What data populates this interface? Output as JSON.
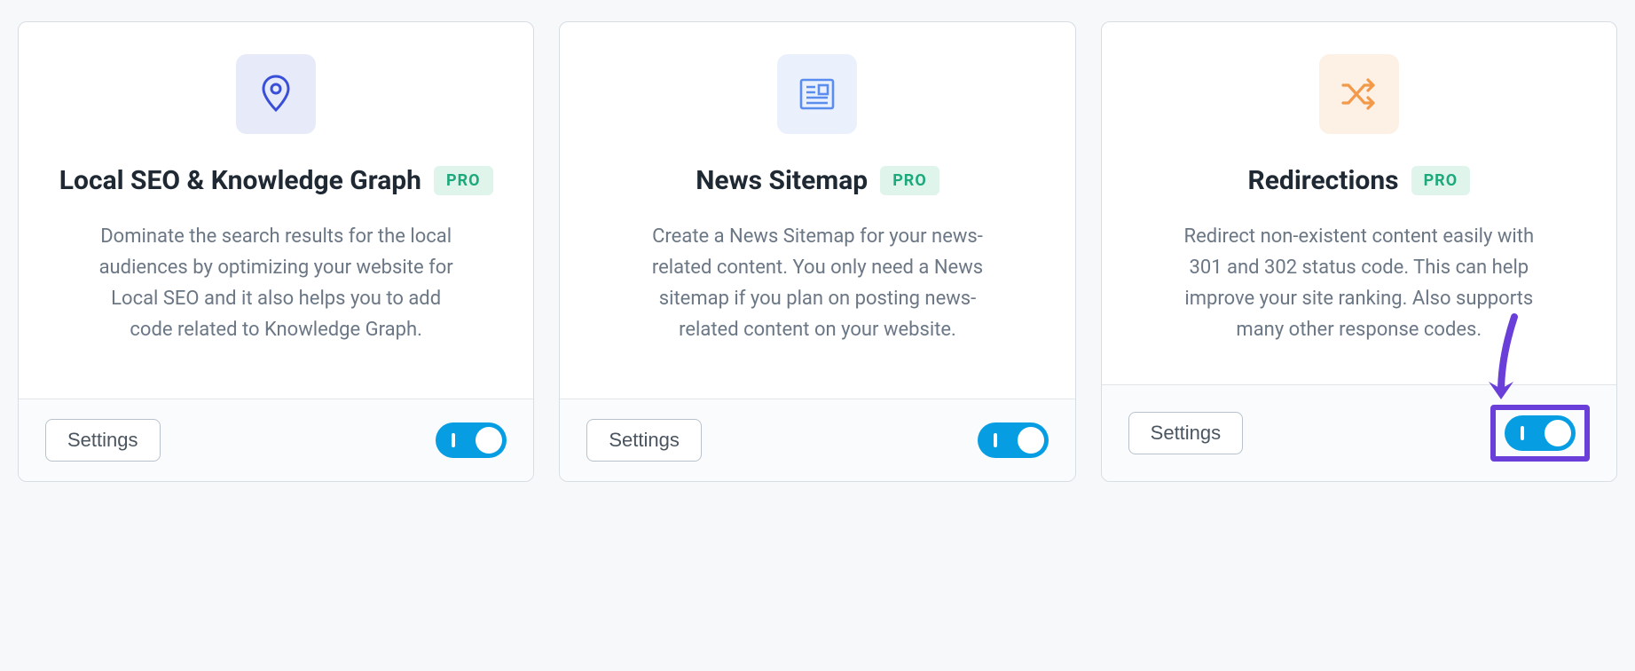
{
  "badge_label": "PRO",
  "settings_label": "Settings",
  "cards": [
    {
      "id": "local-seo",
      "title": "Local SEO & Knowledge Graph",
      "desc": "Dominate the search results for the local audiences by optimizing your website for Local SEO and it also helps you to add code related to Knowledge Graph.",
      "pro": true,
      "toggle_on": true,
      "highlight": false
    },
    {
      "id": "news-sitemap",
      "title": "News Sitemap",
      "desc": "Create a News Sitemap for your news-related content. You only need a News sitemap if you plan on posting news-related content on your website.",
      "pro": true,
      "toggle_on": true,
      "highlight": false
    },
    {
      "id": "redirections",
      "title": "Redirections",
      "desc": "Redirect non-existent content easily with 301 and 302 status code. This can help improve your site ranking. Also supports many other response codes.",
      "pro": true,
      "toggle_on": true,
      "highlight": true
    }
  ]
}
